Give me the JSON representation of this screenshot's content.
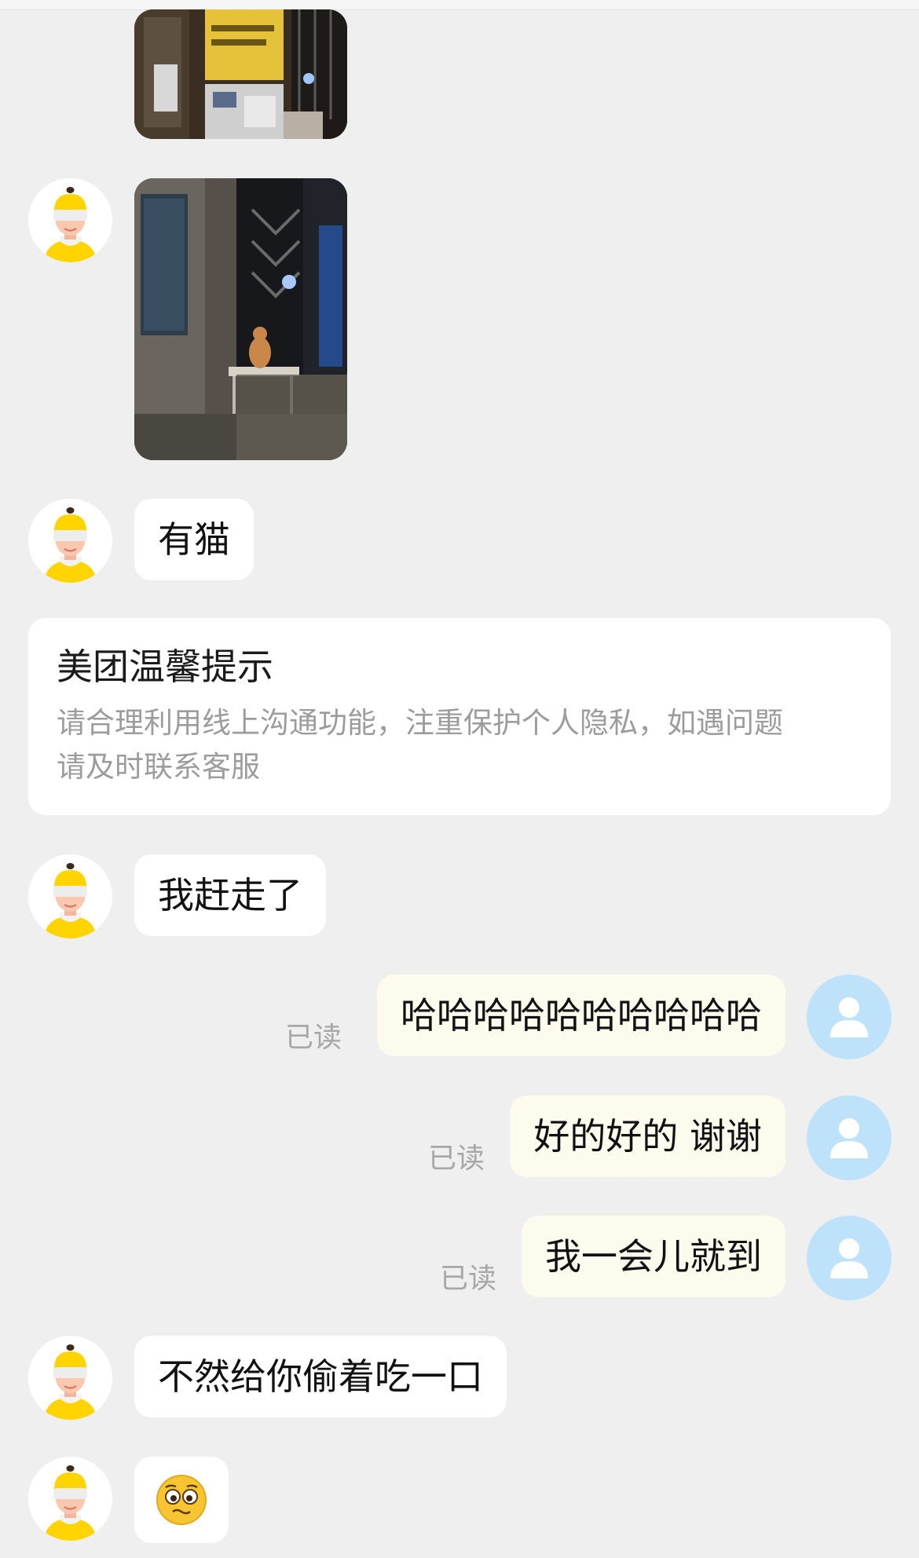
{
  "messages": {
    "incoming_1": "有猫",
    "incoming_2": "我赶走了",
    "outgoing_1": "哈哈哈哈哈哈哈哈哈哈",
    "outgoing_2": "好的好的 谢谢",
    "outgoing_3": "我一会儿就到",
    "incoming_3": "不然给你偷着吃一口"
  },
  "read_status": "已读",
  "notice": {
    "title": "美团温馨提示",
    "body_line1": "请合理利用线上沟通功能，注重保护个人隐私，如遇问题",
    "body_line2": "请及时联系客服"
  },
  "icons": {
    "courier_avatar": "courier-avatar-icon",
    "user_avatar": "user-avatar-icon",
    "emoji": "pleading-face-emoji-icon"
  },
  "colors": {
    "background": "#efefef",
    "incoming_bubble": "#ffffff",
    "outgoing_bubble": "#fdfaee",
    "user_avatar_bg": "#bfe2fb",
    "courier_yellow": "#ffd400",
    "read_text": "#a7a7a7"
  }
}
